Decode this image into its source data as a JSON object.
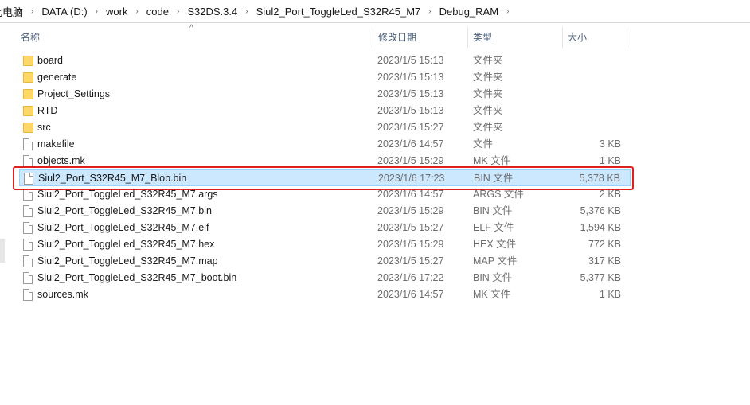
{
  "breadcrumb": [
    "此电脑",
    "DATA (D:)",
    "work",
    "code",
    "S32DS.3.4",
    "Siul2_Port_ToggleLed_S32R45_M7",
    "Debug_RAM"
  ],
  "columns": {
    "name": "名称",
    "date": "修改日期",
    "type": "类型",
    "size": "大小"
  },
  "files": [
    {
      "name": "board",
      "date": "2023/1/5 15:13",
      "type": "文件夹",
      "size": "",
      "kind": "folder"
    },
    {
      "name": "generate",
      "date": "2023/1/5 15:13",
      "type": "文件夹",
      "size": "",
      "kind": "folder"
    },
    {
      "name": "Project_Settings",
      "date": "2023/1/5 15:13",
      "type": "文件夹",
      "size": "",
      "kind": "folder"
    },
    {
      "name": "RTD",
      "date": "2023/1/5 15:13",
      "type": "文件夹",
      "size": "",
      "kind": "folder"
    },
    {
      "name": "src",
      "date": "2023/1/5 15:27",
      "type": "文件夹",
      "size": "",
      "kind": "folder"
    },
    {
      "name": "makefile",
      "date": "2023/1/6 14:57",
      "type": "文件",
      "size": "3 KB",
      "kind": "file"
    },
    {
      "name": "objects.mk",
      "date": "2023/1/5 15:29",
      "type": "MK 文件",
      "size": "1 KB",
      "kind": "file"
    },
    {
      "name": "Siul2_Port_S32R45_M7_Blob.bin",
      "date": "2023/1/6 17:23",
      "type": "BIN 文件",
      "size": "5,378 KB",
      "kind": "file",
      "selected": true
    },
    {
      "name": "Siul2_Port_ToggleLed_S32R45_M7.args",
      "date": "2023/1/6 14:57",
      "type": "ARGS 文件",
      "size": "2 KB",
      "kind": "file"
    },
    {
      "name": "Siul2_Port_ToggleLed_S32R45_M7.bin",
      "date": "2023/1/5 15:29",
      "type": "BIN 文件",
      "size": "5,376 KB",
      "kind": "file"
    },
    {
      "name": "Siul2_Port_ToggleLed_S32R45_M7.elf",
      "date": "2023/1/5 15:27",
      "type": "ELF 文件",
      "size": "1,594 KB",
      "kind": "file"
    },
    {
      "name": "Siul2_Port_ToggleLed_S32R45_M7.hex",
      "date": "2023/1/5 15:29",
      "type": "HEX 文件",
      "size": "772 KB",
      "kind": "file"
    },
    {
      "name": "Siul2_Port_ToggleLed_S32R45_M7.map",
      "date": "2023/1/5 15:27",
      "type": "MAP 文件",
      "size": "317 KB",
      "kind": "file"
    },
    {
      "name": "Siul2_Port_ToggleLed_S32R45_M7_boot.bin",
      "date": "2023/1/6 17:22",
      "type": "BIN 文件",
      "size": "5,377 KB",
      "kind": "file"
    },
    {
      "name": "sources.mk",
      "date": "2023/1/6 14:57",
      "type": "MK 文件",
      "size": "1 KB",
      "kind": "file"
    }
  ],
  "highlight_color": "#e02020"
}
